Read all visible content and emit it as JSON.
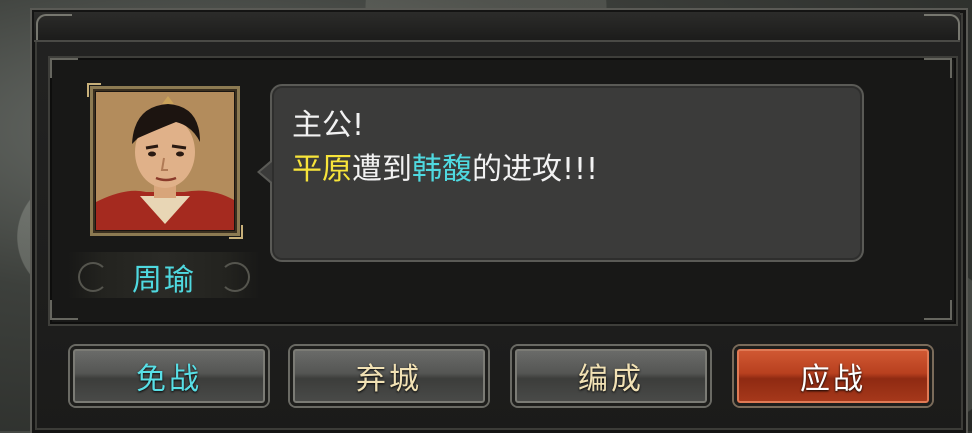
{
  "general": {
    "name": "周瑜"
  },
  "dialog": {
    "greeting": "主公!",
    "message": {
      "city": "平原",
      "text1": "遭到",
      "enemy": "韩馥",
      "text2": "的进攻!!!"
    }
  },
  "buttons": {
    "avoid": "免战",
    "abandon": "弃城",
    "formation": "编成",
    "fight": "应战"
  },
  "colors": {
    "highlight_city": "#f7e43a",
    "highlight_name": "#4fd9e0",
    "primary_button": "#b8401f"
  }
}
